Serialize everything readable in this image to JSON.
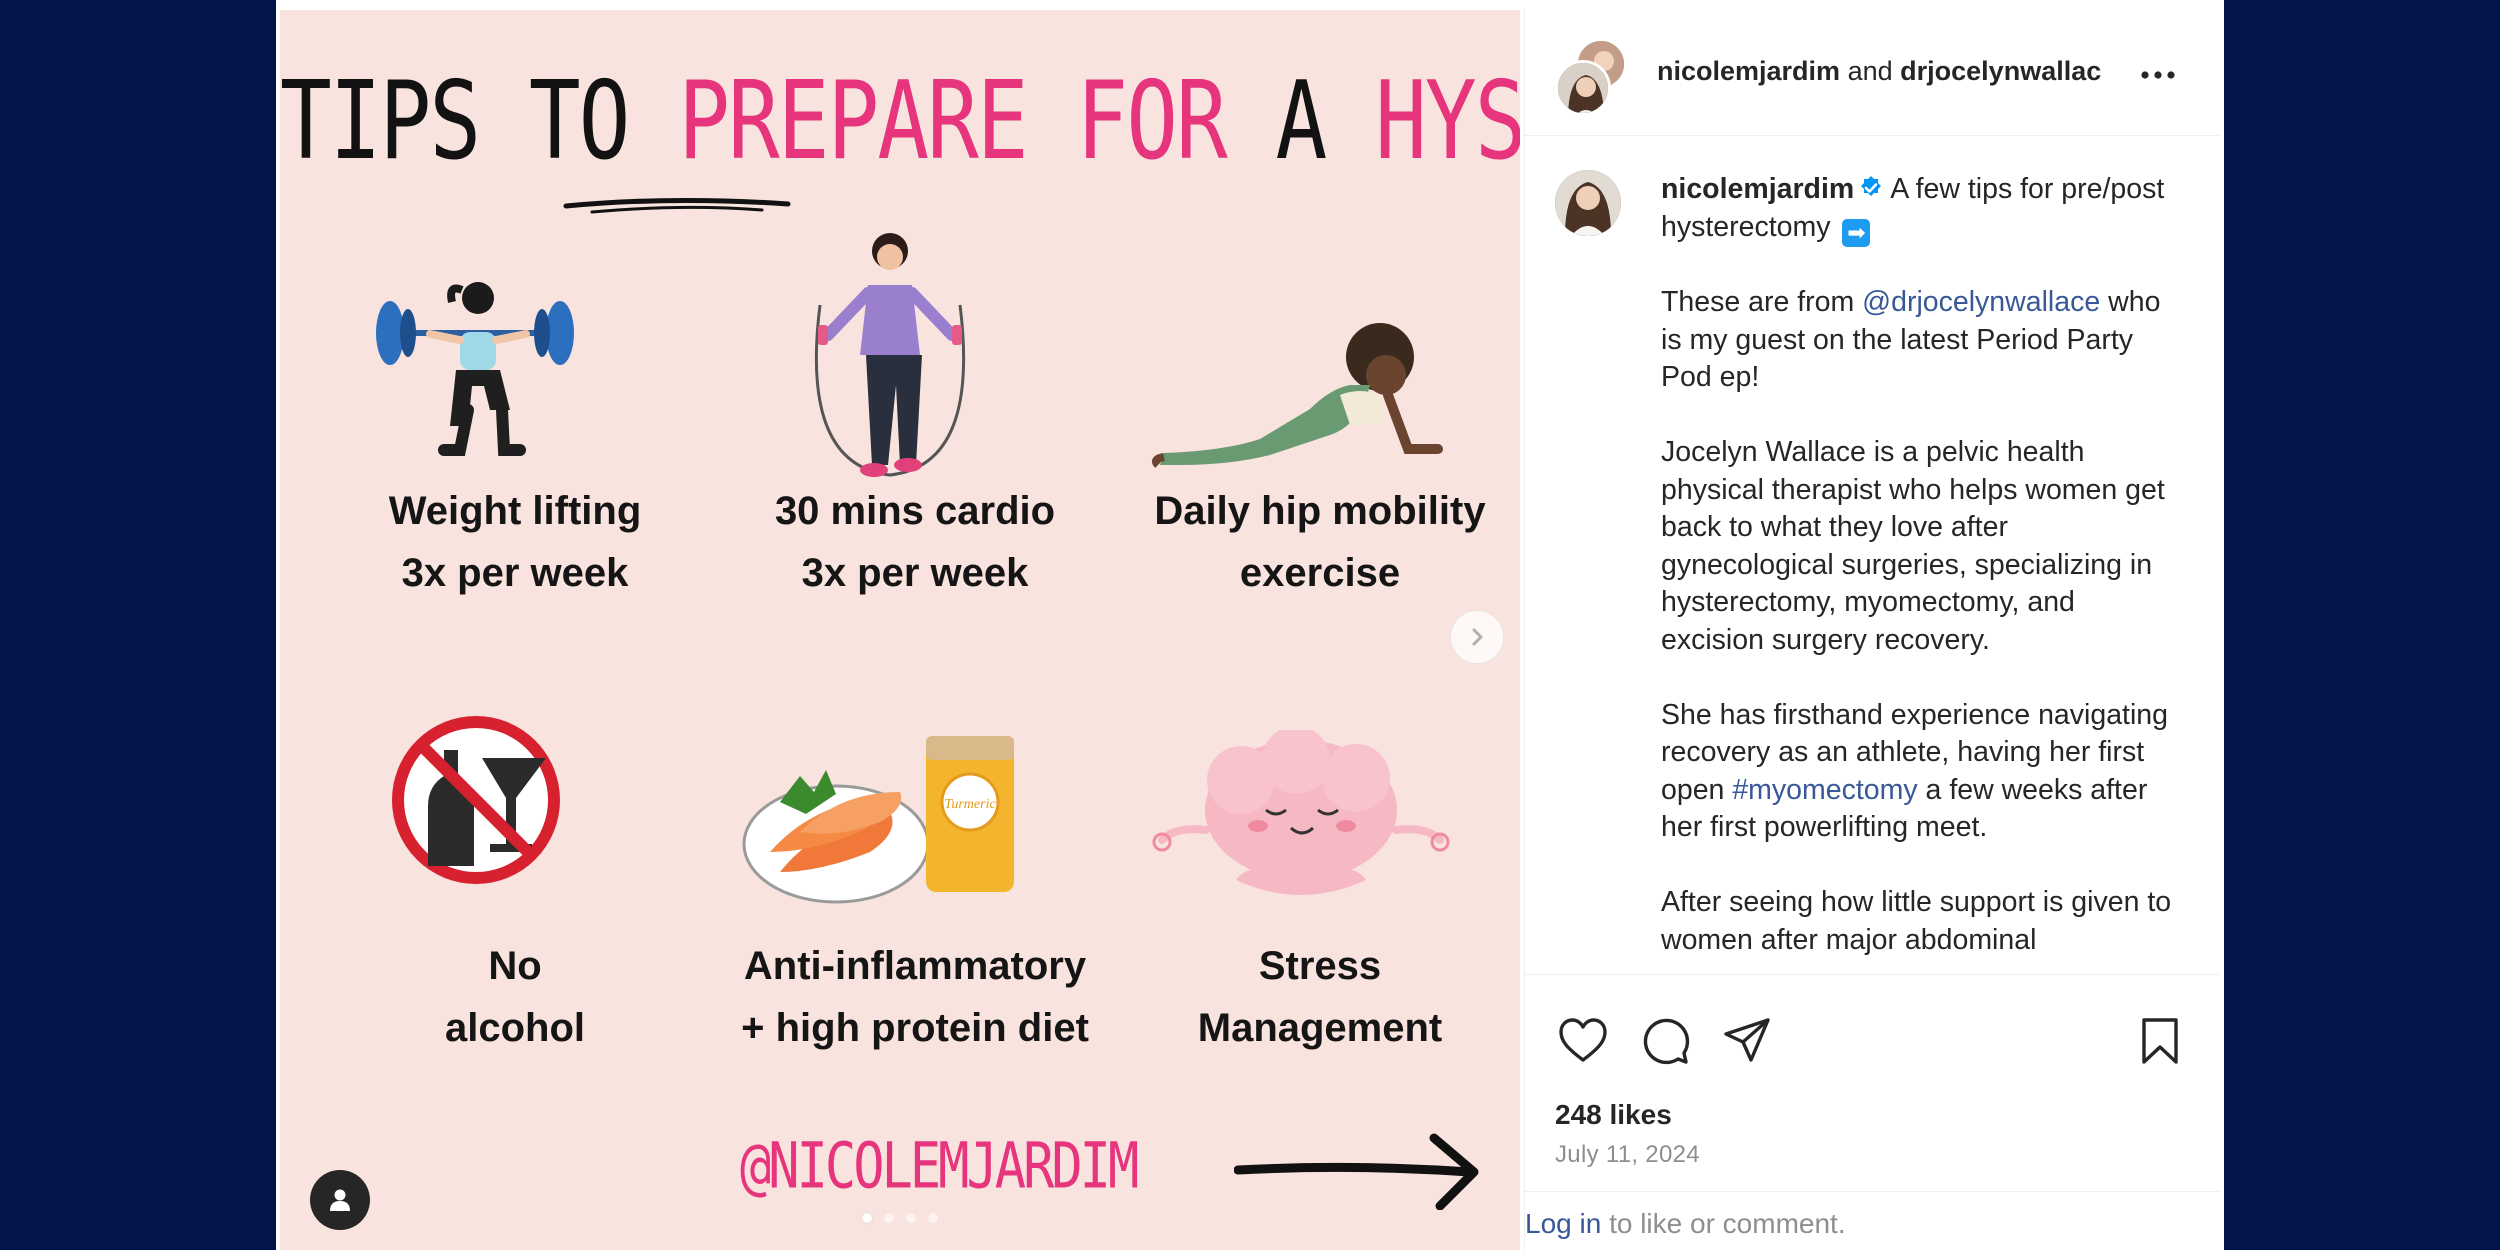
{
  "post_image": {
    "title_part1": "TIPS TO",
    "title_part2": "PREPARE FOR A",
    "title_part3": "A",
    "title_part4": "HYSTERECTOMY",
    "tips": [
      {
        "line1": "Weight lifting",
        "line2": "3x per week",
        "icon": "weightlifting-illustration"
      },
      {
        "line1": "30 mins cardio",
        "line2": "3x per week",
        "icon": "jump-rope-illustration"
      },
      {
        "line1": "Daily hip mobility",
        "line2": "exercise",
        "icon": "cobra-stretch-illustration"
      },
      {
        "line1": "No",
        "line2": "alcohol",
        "icon": "no-alcohol-icon"
      },
      {
        "line1": "Anti-inflammatory",
        "line2": "+ high protein diet",
        "icon": "salmon-turmeric-illustration"
      },
      {
        "line1": "Stress",
        "line2": "Management",
        "icon": "meditating-brain-illustration"
      }
    ],
    "jar_label": "Turmeric",
    "handle": "@NICOLEMJARDIM",
    "carousel_dots": 4,
    "active_dot": 0
  },
  "header": {
    "user1": "nicolemjardim",
    "joiner": "and",
    "user2": "drjocelynwallac"
  },
  "caption": {
    "username": "nicolemjardim",
    "intro": "A few tips for pre/post hysterectomy",
    "arrow_emoji": "➡",
    "p1_before": "These are from",
    "p1_mention": "@drjocelynwallace",
    "p1_after": "who is my guest on the latest Period Party Pod ep!",
    "p2": "Jocelyn Wallace is a pelvic health physical therapist who helps women get back to what they love after gynecological surgeries, specializing in hysterectomy, myomectomy, and excision surgery recovery.",
    "p3_before": "She has firsthand experience navigating recovery as an athlete, having her first open",
    "p3_hashtag": "#myomectomy",
    "p3_after": "a few weeks after her first powerlifting meet.",
    "p4": "After seeing how little support is given to women after major abdominal"
  },
  "actions": {
    "likes": "248 likes",
    "date": "July 11, 2024"
  },
  "login": {
    "link": "Log in",
    "rest": "to like or comment."
  },
  "colors": {
    "background": "#03154a",
    "poster_bg": "#f9e3de",
    "accent_pink": "#e6357d",
    "link_blue": "#385898",
    "verified_blue": "#0095f6"
  }
}
